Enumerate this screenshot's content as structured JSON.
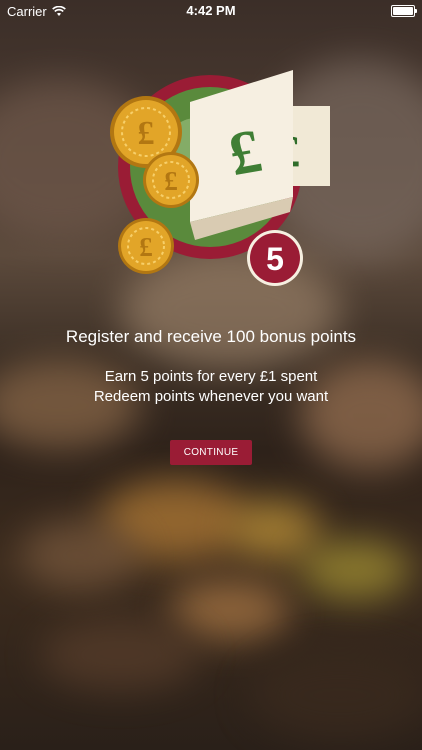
{
  "status_bar": {
    "carrier": "Carrier",
    "time": "4:42 PM"
  },
  "hero": {
    "badge_number": "5",
    "currency_symbol": "£",
    "icon": "loyalty-points-icon"
  },
  "content": {
    "headline": "Register and receive 100 bonus points",
    "line1": "Earn 5 points for every £1 spent",
    "line2": "Redeem points whenever you want"
  },
  "actions": {
    "continue_label": "CONTINUE"
  },
  "colors": {
    "accent": "#9a1c35",
    "green": "#5a8a3c",
    "gold": "#e0a32a"
  }
}
